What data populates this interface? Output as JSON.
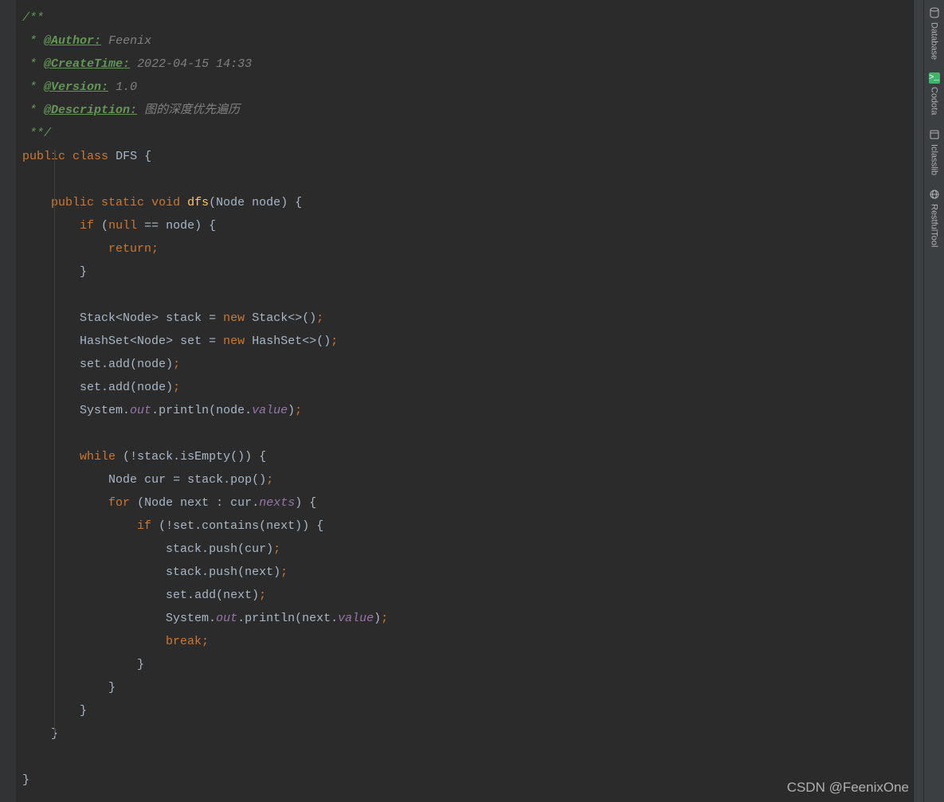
{
  "code": {
    "comment_open": "/**",
    "author_tag": "@Author:",
    "author_value": "Feenix",
    "createtime_tag": "@CreateTime:",
    "createtime_value": "2022-04-15 14:33",
    "version_tag": "@Version:",
    "version_value": "1.0",
    "description_tag": "@Description:",
    "description_value": "图的深度优先遍历",
    "comment_close": "*/",
    "star": " *",
    "public": "public",
    "class": "class",
    "classname": "DFS",
    "static": "static",
    "void": "void",
    "methodname": "dfs",
    "node_type": "Node",
    "node_param": "node",
    "if": "if",
    "null": "null",
    "eq": "==",
    "return": "return",
    "stack_type": "Stack",
    "stack_var": "stack",
    "assign": "=",
    "new": "new",
    "hashset_type": "HashSet",
    "set_var": "set",
    "add": "add",
    "system": "System",
    "out": "out",
    "println": "println",
    "value": "value",
    "while": "while",
    "not": "!",
    "isempty": "isEmpty",
    "cur_var": "cur",
    "pop": "pop",
    "for": "for",
    "next_var": "next",
    "colon": ":",
    "nexts": "nexts",
    "contains": "contains",
    "push": "push",
    "break": "break",
    "lbrace": "{",
    "rbrace": "}",
    "lparen": "(",
    "rparen": ")",
    "lt": "<",
    "gt": ">",
    "ltgt": "<>",
    "dot": ".",
    "semi": ";",
    "sp1": " ",
    "sp4": "    ",
    "sp8": "        ",
    "sp12": "            ",
    "sp16": "                ",
    "sp20": "                    "
  },
  "tools": {
    "database": "Database",
    "codota": "Codota",
    "classlib": "Iclasslib",
    "restful": "RestfulTool"
  },
  "watermark": "CSDN @FeenixOne"
}
